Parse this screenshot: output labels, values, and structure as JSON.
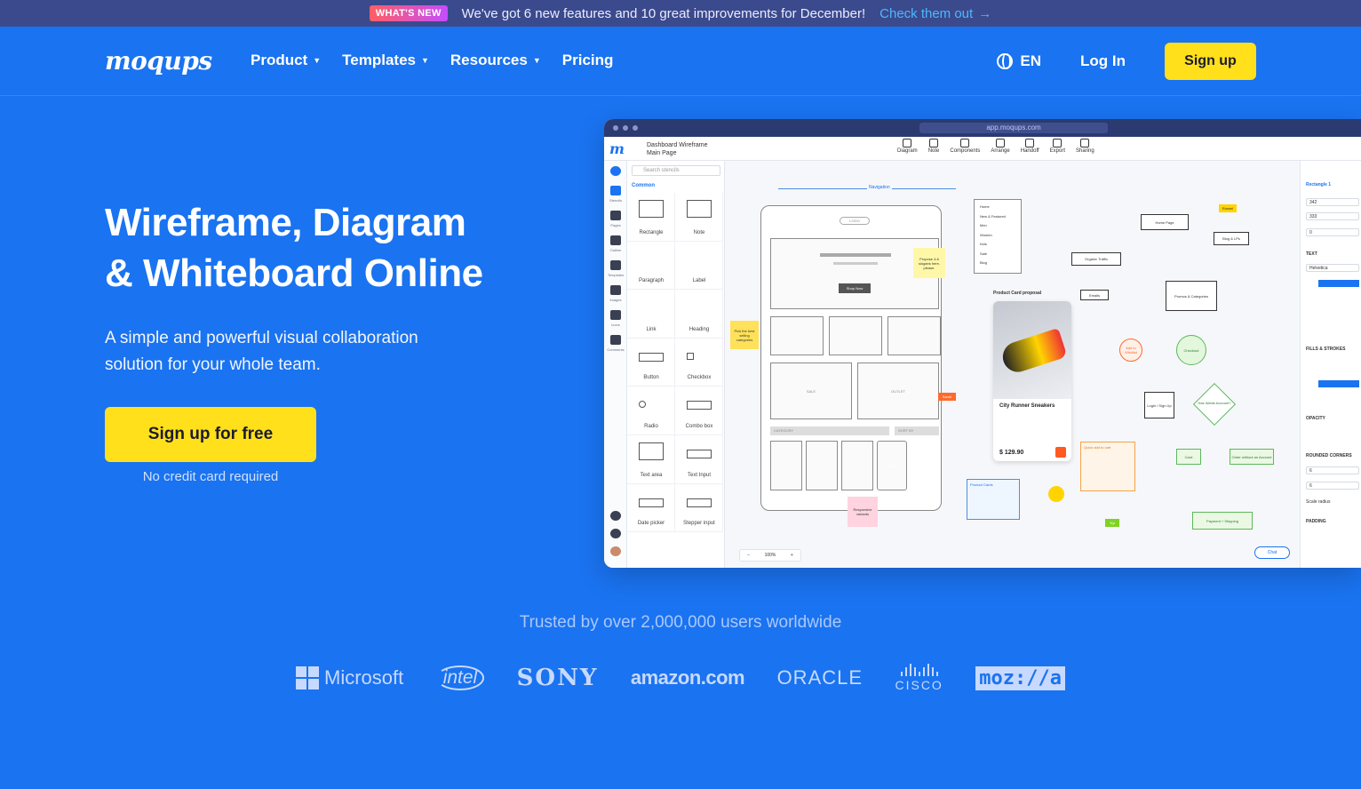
{
  "announcement": {
    "badge": "WHAT'S NEW",
    "message": "We've got 6 new features and 10 great improvements for December!",
    "link": "Check them out",
    "arrow": "→"
  },
  "nav": {
    "logo": "moqups",
    "menu": [
      {
        "label": "Product",
        "has_caret": true
      },
      {
        "label": "Templates",
        "has_caret": true
      },
      {
        "label": "Resources",
        "has_caret": true
      },
      {
        "label": "Pricing",
        "has_caret": false
      }
    ],
    "language": "EN",
    "login": "Log In",
    "signup": "Sign up"
  },
  "hero": {
    "title_line1": "Wireframe, Diagram",
    "title_line2": "& Whiteboard Online",
    "subtitle": "A simple and powerful visual collaboration solution for your whole team.",
    "cta": "Sign up for free",
    "note": "No credit card required"
  },
  "mockup": {
    "url": "app.moqups.com",
    "doc_title": "Dashboard Wireframe",
    "doc_page": "Main Page",
    "toolbar": [
      "Diagram",
      "Note",
      "Components",
      "Arrange",
      "Handoff",
      "Export",
      "Sharing"
    ],
    "left_bar": [
      "Stencils",
      "Pages",
      "Outline",
      "Templates",
      "Images",
      "Icons",
      "Comments"
    ],
    "stencil_search": "Search stencils",
    "stencil_group": "Common",
    "stencils": [
      "Rectangle",
      "Note",
      "Paragraph",
      "Label",
      "Link",
      "Heading",
      "Button",
      "Checkbox",
      "Radio",
      "Combo box",
      "Text area",
      "Text Input",
      "Date picker",
      "Stepper input"
    ],
    "right_panel": {
      "shape": "Rectangle 1",
      "x": "342",
      "y": "333",
      "rotation": "0",
      "text_section": "TEXT",
      "font": "Helvetica",
      "fills_section": "FILLS & STROKES",
      "opacity_section": "OPACITY",
      "corners_section": "ROUNDED CORNERS",
      "corner_1": "6",
      "corner_2": "6",
      "scale_radius": "Scale radius",
      "padding_section": "PADDING"
    },
    "canvas": {
      "navigation": "Navigation",
      "logo": "LOGO",
      "shop_now": "Shop Now",
      "sale": "SALE",
      "outlet": "OUTLET",
      "category": "CATEGORY",
      "sort_by": "SORT BY",
      "card": "Card",
      "menu_items": [
        "Home",
        "New & Featured",
        "Men",
        "Women",
        "Kids",
        "Sale",
        "Blog"
      ],
      "sticky_1": "Propose 4-6 slogans here, please.",
      "sticky_2": "Pick the best selling categories",
      "sticky_3": "Responsive variants",
      "product_label": "Product Card proposal",
      "product_name": "City Runner Sneakers",
      "product_price": "$ 129.90",
      "product_cards_note": "Product Cards",
      "quick_add": "Quick add to cart",
      "cursor_sarah": "Sarah",
      "cursor_russel": "Russel",
      "cursor_yiyi": "Yiyi",
      "flow_nodes": [
        "Home Page",
        "Blog & LPs",
        "Organic Traffic",
        "Emails",
        "Promos & Categories",
        "Checkout",
        "Add to Wishlist",
        "Login / Sign Up",
        "Has Wants Account?",
        "Card",
        "Order without an Account",
        "Payment + Shipping"
      ],
      "zoom": "100%",
      "chat": "Chat"
    }
  },
  "trusted": {
    "text": "Trusted by over 2,000,000 users worldwide",
    "logos": [
      "Microsoft",
      "intel",
      "SONY",
      "amazon.com",
      "ORACLE",
      "CISCO",
      "moz://a"
    ]
  }
}
